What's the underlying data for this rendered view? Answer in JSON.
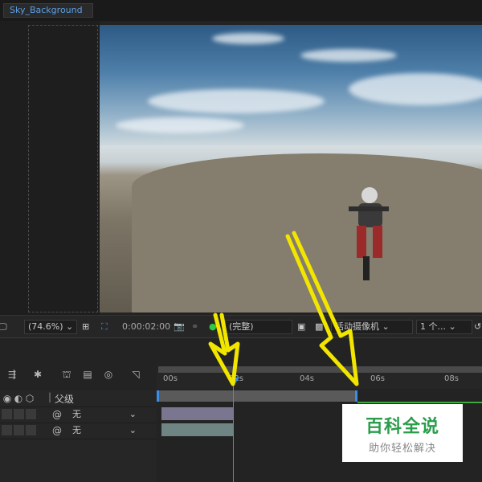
{
  "tab": {
    "title": "Sky_Background"
  },
  "viewer_toolbar": {
    "zoom": "(74.6%)",
    "timecode": "0:00:02:00",
    "resolution": "(完整)",
    "camera": "活动摄像机",
    "views": "1 个..."
  },
  "timeline": {
    "column_parent": "父级",
    "ruler": [
      "00s",
      "02s",
      "04s",
      "06s",
      "08s"
    ],
    "layers": [
      {
        "parent": "无"
      },
      {
        "parent": "无"
      }
    ]
  },
  "watermark": {
    "title": "百科全说",
    "subtitle": "助你轻松解决"
  },
  "colors": {
    "accent": "#3a8ee6",
    "arrow": "#f2e500",
    "watermark_green": "#2a9d4b"
  }
}
